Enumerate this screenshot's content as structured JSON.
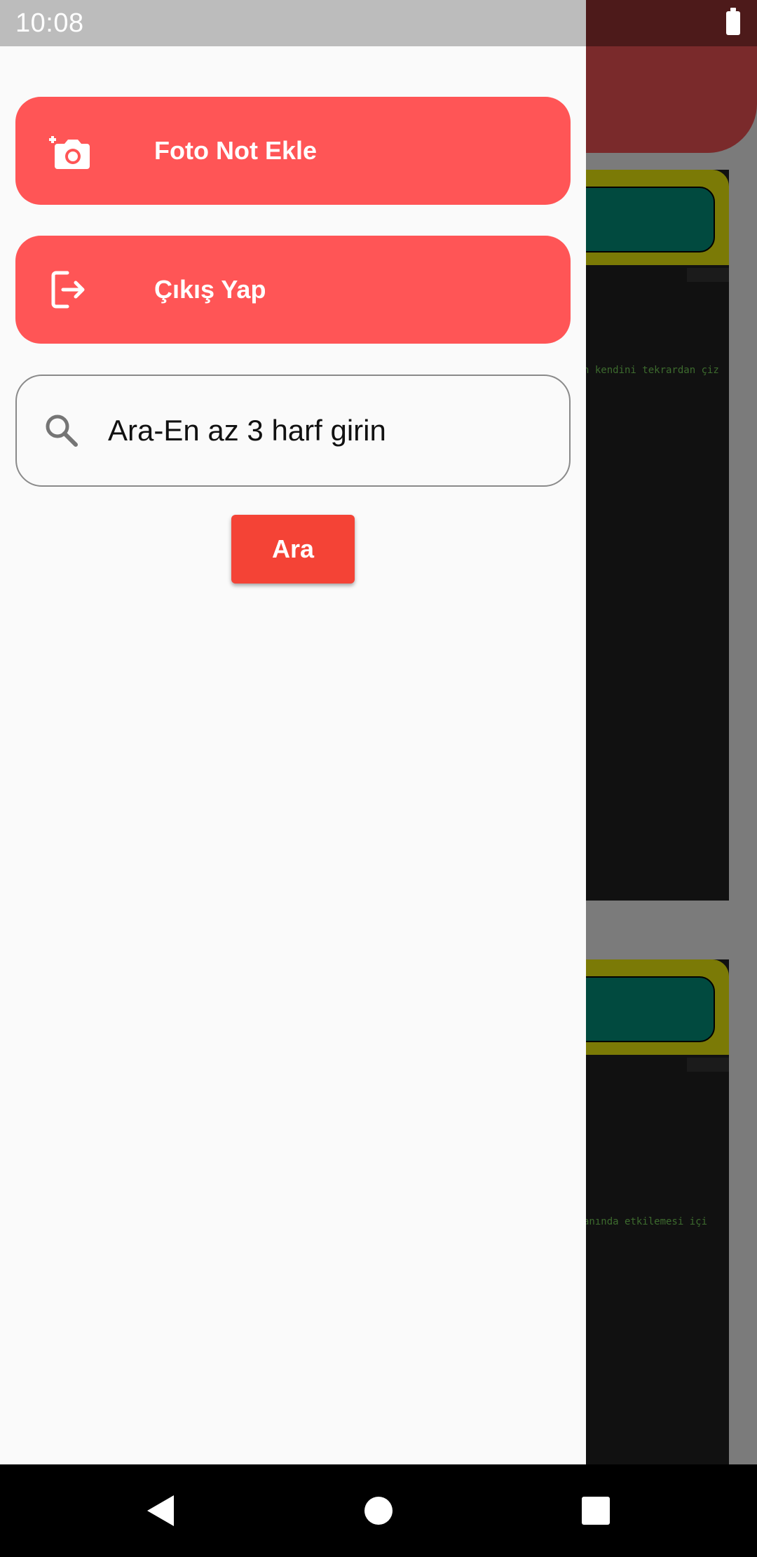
{
  "status_bar": {
    "time": "10:08",
    "battery_icon": "battery-full-icon"
  },
  "drawer": {
    "items": [
      {
        "label": "Foto Not Ekle",
        "icon": "add-photo-icon"
      },
      {
        "label": "Çıkış Yap",
        "icon": "logout-icon"
      }
    ],
    "search": {
      "placeholder": "Ara-En az 3 harf girin",
      "value": "",
      "icon": "search-icon"
    },
    "search_button": {
      "label": "Ara"
    }
  },
  "background": {
    "cards": [
      {
        "code_text": "n kendini tekrardan çiz"
      },
      {
        "code_text": " anında etkilemesi içi"
      }
    ]
  },
  "nav_bar": {
    "back_icon": "back-triangle-icon",
    "home_icon": "home-circle-icon",
    "recents_icon": "recents-square-icon"
  },
  "colors": {
    "drawer_button": "#ff5556",
    "search_button": "#f44336",
    "app_bar": "#7a2a2b",
    "drawer_background": "#fafafa"
  }
}
